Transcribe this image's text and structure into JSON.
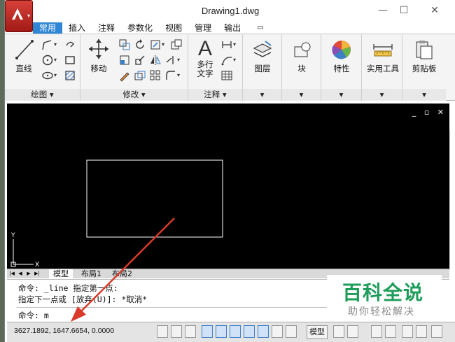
{
  "window": {
    "title": "Drawing1.dwg",
    "controls": {
      "minimize": "—",
      "maximize": "☐",
      "close": "✕"
    }
  },
  "tabs": [
    "常用",
    "插入",
    "注释",
    "参数化",
    "视图",
    "管理",
    "输出",
    "▭"
  ],
  "active_tab": "常用",
  "ribbon": {
    "line_tool": "直线",
    "move_tool": "移动",
    "mtext_tool": "多行\n文字",
    "layer_tool": "图层",
    "block_tool": "块",
    "properties_tool": "特性",
    "utilities_tool": "实用工具",
    "clipboard_tool": "剪贴板",
    "panels": {
      "draw": "绘图 ▾",
      "modify": "修改 ▾",
      "annotation": "注释 ▾"
    }
  },
  "canvas": {
    "axis_y": "Y",
    "axis_x": "X",
    "controls": "_ ▫ ✕"
  },
  "layout_tabs": [
    "模型",
    "布局1",
    "布局2"
  ],
  "command": {
    "lines": [
      "命令: _line 指定第一点:",
      "指定下一点或 [放弃(U)]: *取消*"
    ],
    "prompt": "命令: m"
  },
  "watermark": {
    "title": "百科全说",
    "subtitle": "助你轻松解决"
  },
  "status": {
    "coordinates": "3627.1892, 1647.6654, 0.0000",
    "model_label": "模型"
  },
  "colors": {
    "accent": "#2f86d6",
    "arrow": "#d93a2b",
    "watermark": "#1e9c5a"
  }
}
